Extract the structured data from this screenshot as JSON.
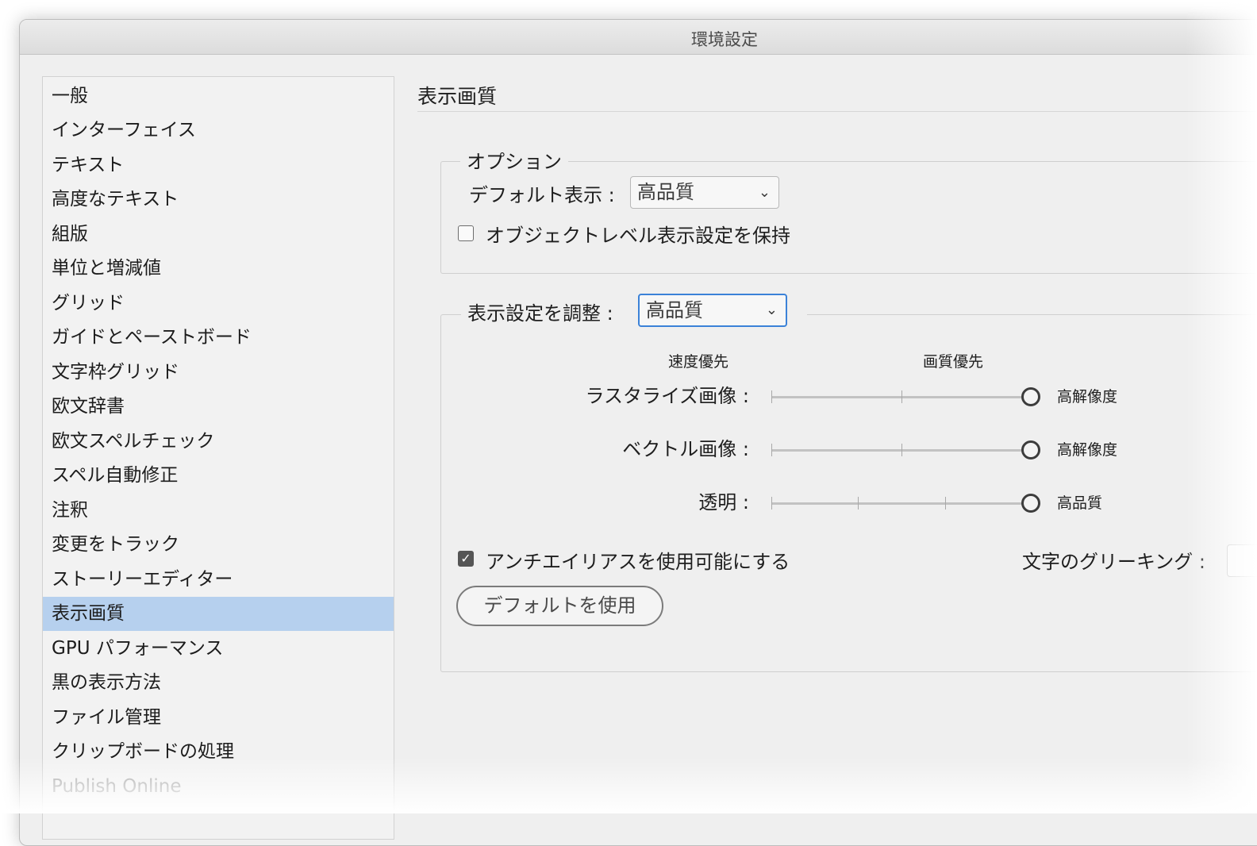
{
  "window": {
    "title": "環境設定"
  },
  "sidebar": {
    "items": [
      {
        "label": "一般"
      },
      {
        "label": "インターフェイス"
      },
      {
        "label": "テキスト"
      },
      {
        "label": "高度なテキスト"
      },
      {
        "label": "組版"
      },
      {
        "label": "単位と増減値"
      },
      {
        "label": "グリッド"
      },
      {
        "label": "ガイドとペーストボード"
      },
      {
        "label": "文字枠グリッド"
      },
      {
        "label": "欧文辞書"
      },
      {
        "label": "欧文スペルチェック"
      },
      {
        "label": "スペル自動修正"
      },
      {
        "label": "注釈"
      },
      {
        "label": "変更をトラック"
      },
      {
        "label": "ストーリーエディター"
      },
      {
        "label": "表示画質"
      },
      {
        "label": "GPU パフォーマンス"
      },
      {
        "label": "黒の表示方法"
      },
      {
        "label": "ファイル管理"
      },
      {
        "label": "クリップボードの処理"
      },
      {
        "label": "Publish Online"
      }
    ],
    "selected": "表示画質"
  },
  "main": {
    "section_title": "表示画質",
    "options": {
      "legend": "オプション",
      "default_view_label": "デフォルト表示 :",
      "default_view_value": "高品質",
      "preserve_object_label": "オブジェクトレベル表示設定を保持",
      "preserve_object_checked": false
    },
    "adjust": {
      "label": "表示設定を調整 :",
      "value": "高品質",
      "speed_label": "速度優先",
      "quality_label": "画質優先",
      "rows": [
        {
          "label": "ラスタライズ画像 :",
          "value_text": "高解像度",
          "level": 1.0
        },
        {
          "label": "ベクトル画像 :",
          "value_text": "高解像度",
          "level": 1.0
        },
        {
          "label": "透明 :",
          "value_text": "高品質",
          "level": 1.0
        }
      ],
      "antialias_label": "アンチエイリアスを使用可能にする",
      "antialias_checked": true,
      "greek_label": "文字のグリーキング :",
      "default_button": "デフォルトを使用"
    }
  },
  "icons": {
    "chevron": "chevron-down-icon",
    "check": "checkmark-icon"
  },
  "colors": {
    "selection": "#b6d0ee",
    "focus": "#3b82d8"
  }
}
